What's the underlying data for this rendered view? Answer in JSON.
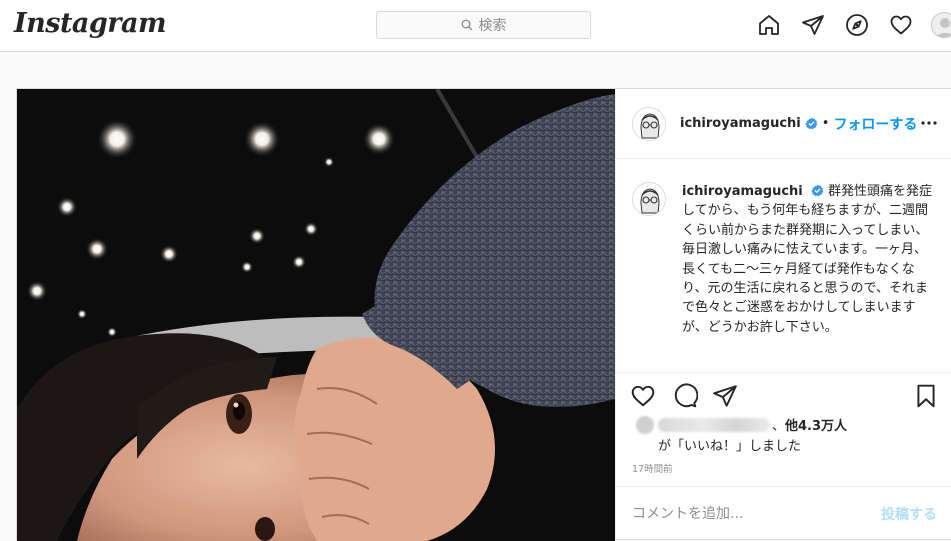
{
  "brand": {
    "logo_text": "Instagram"
  },
  "search": {
    "placeholder": "検索"
  },
  "nav": {
    "icons": [
      "home-icon",
      "direct-icon",
      "explore-icon",
      "activity-icon",
      "profile-avatar"
    ]
  },
  "post": {
    "username": "ichiroyamaguchi",
    "separator": "•",
    "follow_label": "フォローする",
    "caption": "群発性頭痛を発症してから、もう何年も経ちますが、二週間くらい前からまた群発期に入ってしまい、毎日激しい痛みに怯えています。一ヶ月、長くても二〜三ヶ月経てば発作もなくなり、元の生活に戻れると思うので、それまで色々とご迷惑をおかけしてしまいますが、どうかお許し下さい。",
    "likes_others": "他4.3万人",
    "likes_prefix": "、",
    "likes_suffix": "が「いいね！」しました",
    "timestamp": "17時間前",
    "comment_placeholder": "コメントを追加...",
    "post_button": "投稿する"
  },
  "colors": {
    "accent": "#0095f6",
    "post_disabled": "#b2dffc",
    "border": "#dbdbdb"
  }
}
